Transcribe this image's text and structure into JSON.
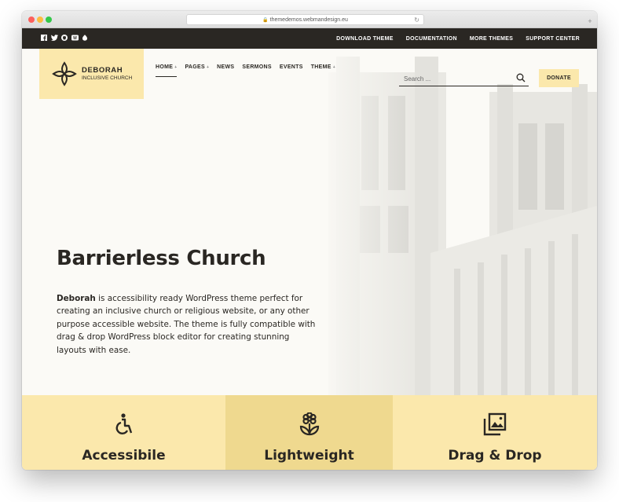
{
  "browser": {
    "url": "themedemos.webmandesign.eu"
  },
  "topbar": {
    "social_icons": [
      "facebook-icon",
      "twitter-icon",
      "github-icon",
      "wordpress-icon",
      "instagram-icon"
    ],
    "links": [
      "DOWNLOAD THEME",
      "DOCUMENTATION",
      "MORE THEMES",
      "SUPPORT CENTER"
    ]
  },
  "logo": {
    "name": "DEBORAH",
    "tagline": "INCLUSIVE CHURCH"
  },
  "nav": {
    "items": [
      {
        "label": "HOME",
        "has_dropdown": true
      },
      {
        "label": "PAGES",
        "has_dropdown": true
      },
      {
        "label": "NEWS",
        "has_dropdown": false
      },
      {
        "label": "SERMONS",
        "has_dropdown": false
      },
      {
        "label": "EVENTS",
        "has_dropdown": false
      },
      {
        "label": "THEME",
        "has_dropdown": true
      }
    ],
    "dropdown_caret": "+"
  },
  "search": {
    "placeholder": "Search ..."
  },
  "donate_label": "DONATE",
  "hero": {
    "title": "Barrierless Church",
    "text_strong": "Deborah",
    "text_rest": " is accessibility ready WordPress theme perfect for creating an inclusive church or religious website, or any other purpose accessible website. The theme is fully compatible with drag & drop WordPress block editor for creating stunning layouts with ease."
  },
  "features": [
    {
      "icon": "accessibility-icon",
      "label": "Accessibile"
    },
    {
      "icon": "flower-icon",
      "label": "Lightweight"
    },
    {
      "icon": "images-icon",
      "label": "Drag & Drop"
    }
  ],
  "colors": {
    "dark": "#2a2723",
    "accent": "#fbe8ac",
    "accent_dark": "#efd98f",
    "background": "#fbfaf6"
  }
}
